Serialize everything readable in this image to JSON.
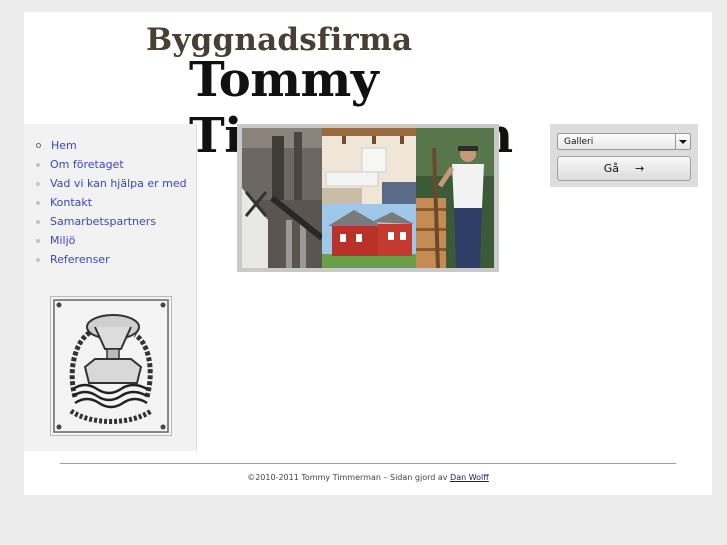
{
  "header": {
    "title_small": "Byggnadsfirma",
    "title_large": "Tommy Timmerman"
  },
  "nav": {
    "items": [
      {
        "label": "Hem",
        "active": true
      },
      {
        "label": "Om företaget"
      },
      {
        "label": "Vad vi kan hjälpa er med"
      },
      {
        "label": "Kontakt"
      },
      {
        "label": "Samarbetspartners"
      },
      {
        "label": "Miljö"
      },
      {
        "label": "Referenser"
      }
    ]
  },
  "gallery": {
    "select_value": "Galleri",
    "go_label": "Gå",
    "go_icon": "arrow-right-icon"
  },
  "footer": {
    "text": "©2010-2011 Tommy Timmerman – Sidan gjord av ",
    "link": "Dan Wolff"
  },
  "colors": {
    "link": "#3a46c4",
    "title_small": "#4a3f33",
    "title_large": "#111111",
    "sidebar_bg": "#f2f2f2"
  }
}
